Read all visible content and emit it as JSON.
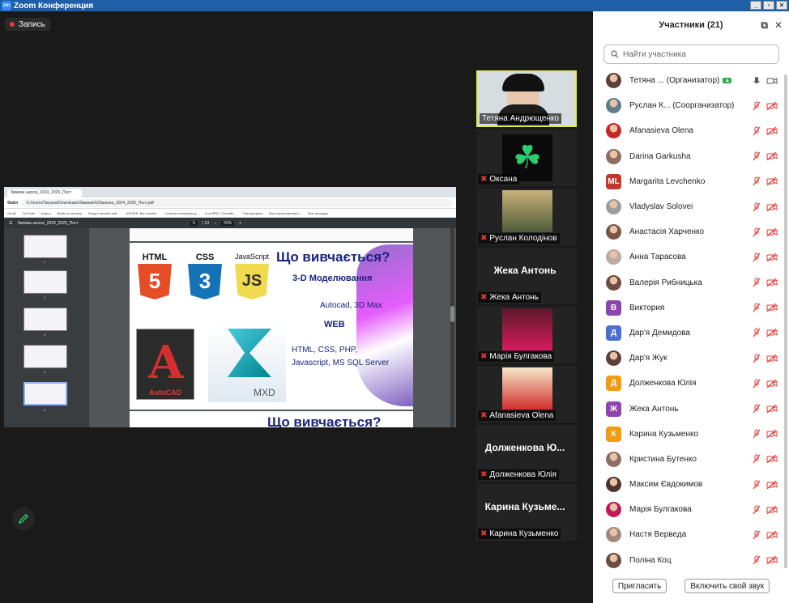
{
  "window": {
    "title": "Zoom Конференция",
    "logo": "zm"
  },
  "recording": {
    "label": "Запись"
  },
  "shared_screen": {
    "browser_tab": "Зимова школа_2024_2025_Пост",
    "url": "C:/Users/Tatyana/Downloads/Зимова%20школа_2024_2025_Пост.pdf",
    "file_badge": "Файл",
    "bookmarks": [
      "Gmail",
      "YouTube",
      "Карты",
      "Boйти в систему",
      "Вход в личный каб...",
      "UNIVER: Всі онлайн...",
      "Інтернет-конференц...",
      "iLovePDF | Онлайн...",
      "Типографика",
      "Как спроектировать...",
      "Все закладки"
    ],
    "pdf_toolbar": {
      "doc_name": "Зимова школа_2024_2025_Пост",
      "page_current": "6",
      "page_total": "/ 13",
      "zoom": "50%"
    },
    "thumb_numbers": [
      "2",
      "3",
      "4",
      "5",
      "6"
    ],
    "slide": {
      "heading": "Що вивчається?",
      "logos": {
        "html": "HTML",
        "css": "CSS",
        "js": "JavaScript",
        "html_num": "5",
        "css_num": "3",
        "js_num": "JS"
      },
      "line1": "3-D Моделювання",
      "line2": "Autocad, 3D Max",
      "line3": "WEB",
      "line4": "HTML, CSS, PHP,",
      "line5": "Javascript,  MS SQL Server",
      "autocad_label": "AutoCAD",
      "autocad_letter": "A",
      "mxd_label": "MXD"
    },
    "slide2_heading": "Що вивчається?"
  },
  "videos": [
    {
      "name": "Тетяна Андрющенко",
      "muted": false,
      "active": true
    },
    {
      "name": "Оксана",
      "muted": true
    },
    {
      "name": "Руслан Колодінов",
      "muted": true
    },
    {
      "name": "Жека Антонь",
      "big": "Жека Антонь",
      "muted": true
    },
    {
      "name": "Марія Булгакова",
      "muted": true
    },
    {
      "name": "Afanasieva Olena",
      "muted": true
    },
    {
      "name": "Долженкова Юлія",
      "big": "Долженкова  Ю...",
      "muted": true
    },
    {
      "name": "Карина Кузьменко",
      "big": "Карина  Кузьме...",
      "muted": true
    }
  ],
  "panel": {
    "title": "Участники (21)",
    "search_placeholder": "Найти участника",
    "participants": [
      {
        "name": "Тетяна ... (Организатор)",
        "avatar": "photo",
        "color": "#5d4037"
      },
      {
        "name": "Руслан К... (Соорганизатор)",
        "avatar": "photo",
        "color": "#607d8b"
      },
      {
        "name": "Afanasieva Olena",
        "avatar": "photo",
        "color": "#c62828"
      },
      {
        "name": "Darina Garkusha",
        "avatar": "photo",
        "color": "#8d6e63"
      },
      {
        "name": "Margarita Levchenko",
        "avatar": "ML",
        "color": "#c0392b"
      },
      {
        "name": "Vladyslav Solovei",
        "avatar": "photo",
        "color": "#9e9e9e"
      },
      {
        "name": "Анастасія Харченко",
        "avatar": "photo",
        "color": "#795548"
      },
      {
        "name": "Анна Тарасова",
        "avatar": "photo",
        "color": "#bcaaa4"
      },
      {
        "name": "Валерія Рибницька",
        "avatar": "photo",
        "color": "#6d4c41"
      },
      {
        "name": "Виктория",
        "avatar": "В",
        "color": "#8e44ad"
      },
      {
        "name": "Дар'я Демидова",
        "avatar": "Д",
        "color": "#4a6fd1"
      },
      {
        "name": "Дар'я Жук",
        "avatar": "photo",
        "color": "#5d4037"
      },
      {
        "name": "Долженкова Юлія",
        "avatar": "Д",
        "color": "#f39c12"
      },
      {
        "name": "Жека Антонь",
        "avatar": "Ж",
        "color": "#8e44ad"
      },
      {
        "name": "Карина Кузьменко",
        "avatar": "К",
        "color": "#f39c12"
      },
      {
        "name": "Кристина Бутенко",
        "avatar": "photo",
        "color": "#8d6e63"
      },
      {
        "name": "Максим Євдокимов",
        "avatar": "photo",
        "color": "#4e342e"
      },
      {
        "name": "Марія Булгакова",
        "avatar": "photo",
        "color": "#c2185b"
      },
      {
        "name": "Настя Верведа",
        "avatar": "photo",
        "color": "#a1887f"
      },
      {
        "name": "Поліна Коц",
        "avatar": "photo",
        "color": "#6d4c41"
      }
    ],
    "invite_button": "Пригласить",
    "unmute_button": "Включить свой звук"
  }
}
